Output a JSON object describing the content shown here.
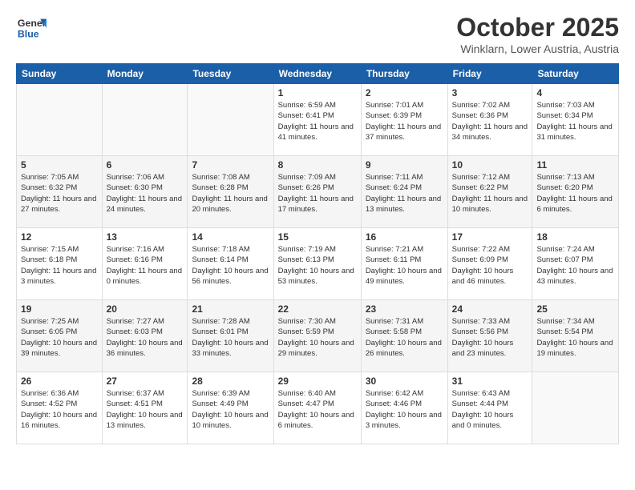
{
  "header": {
    "logo_line1": "General",
    "logo_line2": "Blue",
    "title": "October 2025",
    "subtitle": "Winklarn, Lower Austria, Austria"
  },
  "days_of_week": [
    "Sunday",
    "Monday",
    "Tuesday",
    "Wednesday",
    "Thursday",
    "Friday",
    "Saturday"
  ],
  "weeks": [
    {
      "days": [
        {
          "num": "",
          "info": ""
        },
        {
          "num": "",
          "info": ""
        },
        {
          "num": "",
          "info": ""
        },
        {
          "num": "1",
          "info": "Sunrise: 6:59 AM\nSunset: 6:41 PM\nDaylight: 11 hours and 41 minutes."
        },
        {
          "num": "2",
          "info": "Sunrise: 7:01 AM\nSunset: 6:39 PM\nDaylight: 11 hours and 37 minutes."
        },
        {
          "num": "3",
          "info": "Sunrise: 7:02 AM\nSunset: 6:36 PM\nDaylight: 11 hours and 34 minutes."
        },
        {
          "num": "4",
          "info": "Sunrise: 7:03 AM\nSunset: 6:34 PM\nDaylight: 11 hours and 31 minutes."
        }
      ]
    },
    {
      "days": [
        {
          "num": "5",
          "info": "Sunrise: 7:05 AM\nSunset: 6:32 PM\nDaylight: 11 hours and 27 minutes."
        },
        {
          "num": "6",
          "info": "Sunrise: 7:06 AM\nSunset: 6:30 PM\nDaylight: 11 hours and 24 minutes."
        },
        {
          "num": "7",
          "info": "Sunrise: 7:08 AM\nSunset: 6:28 PM\nDaylight: 11 hours and 20 minutes."
        },
        {
          "num": "8",
          "info": "Sunrise: 7:09 AM\nSunset: 6:26 PM\nDaylight: 11 hours and 17 minutes."
        },
        {
          "num": "9",
          "info": "Sunrise: 7:11 AM\nSunset: 6:24 PM\nDaylight: 11 hours and 13 minutes."
        },
        {
          "num": "10",
          "info": "Sunrise: 7:12 AM\nSunset: 6:22 PM\nDaylight: 11 hours and 10 minutes."
        },
        {
          "num": "11",
          "info": "Sunrise: 7:13 AM\nSunset: 6:20 PM\nDaylight: 11 hours and 6 minutes."
        }
      ]
    },
    {
      "days": [
        {
          "num": "12",
          "info": "Sunrise: 7:15 AM\nSunset: 6:18 PM\nDaylight: 11 hours and 3 minutes."
        },
        {
          "num": "13",
          "info": "Sunrise: 7:16 AM\nSunset: 6:16 PM\nDaylight: 11 hours and 0 minutes."
        },
        {
          "num": "14",
          "info": "Sunrise: 7:18 AM\nSunset: 6:14 PM\nDaylight: 10 hours and 56 minutes."
        },
        {
          "num": "15",
          "info": "Sunrise: 7:19 AM\nSunset: 6:13 PM\nDaylight: 10 hours and 53 minutes."
        },
        {
          "num": "16",
          "info": "Sunrise: 7:21 AM\nSunset: 6:11 PM\nDaylight: 10 hours and 49 minutes."
        },
        {
          "num": "17",
          "info": "Sunrise: 7:22 AM\nSunset: 6:09 PM\nDaylight: 10 hours and 46 minutes."
        },
        {
          "num": "18",
          "info": "Sunrise: 7:24 AM\nSunset: 6:07 PM\nDaylight: 10 hours and 43 minutes."
        }
      ]
    },
    {
      "days": [
        {
          "num": "19",
          "info": "Sunrise: 7:25 AM\nSunset: 6:05 PM\nDaylight: 10 hours and 39 minutes."
        },
        {
          "num": "20",
          "info": "Sunrise: 7:27 AM\nSunset: 6:03 PM\nDaylight: 10 hours and 36 minutes."
        },
        {
          "num": "21",
          "info": "Sunrise: 7:28 AM\nSunset: 6:01 PM\nDaylight: 10 hours and 33 minutes."
        },
        {
          "num": "22",
          "info": "Sunrise: 7:30 AM\nSunset: 5:59 PM\nDaylight: 10 hours and 29 minutes."
        },
        {
          "num": "23",
          "info": "Sunrise: 7:31 AM\nSunset: 5:58 PM\nDaylight: 10 hours and 26 minutes."
        },
        {
          "num": "24",
          "info": "Sunrise: 7:33 AM\nSunset: 5:56 PM\nDaylight: 10 hours and 23 minutes."
        },
        {
          "num": "25",
          "info": "Sunrise: 7:34 AM\nSunset: 5:54 PM\nDaylight: 10 hours and 19 minutes."
        }
      ]
    },
    {
      "days": [
        {
          "num": "26",
          "info": "Sunrise: 6:36 AM\nSunset: 4:52 PM\nDaylight: 10 hours and 16 minutes."
        },
        {
          "num": "27",
          "info": "Sunrise: 6:37 AM\nSunset: 4:51 PM\nDaylight: 10 hours and 13 minutes."
        },
        {
          "num": "28",
          "info": "Sunrise: 6:39 AM\nSunset: 4:49 PM\nDaylight: 10 hours and 10 minutes."
        },
        {
          "num": "29",
          "info": "Sunrise: 6:40 AM\nSunset: 4:47 PM\nDaylight: 10 hours and 6 minutes."
        },
        {
          "num": "30",
          "info": "Sunrise: 6:42 AM\nSunset: 4:46 PM\nDaylight: 10 hours and 3 minutes."
        },
        {
          "num": "31",
          "info": "Sunrise: 6:43 AM\nSunset: 4:44 PM\nDaylight: 10 hours and 0 minutes."
        },
        {
          "num": "",
          "info": ""
        }
      ]
    }
  ]
}
